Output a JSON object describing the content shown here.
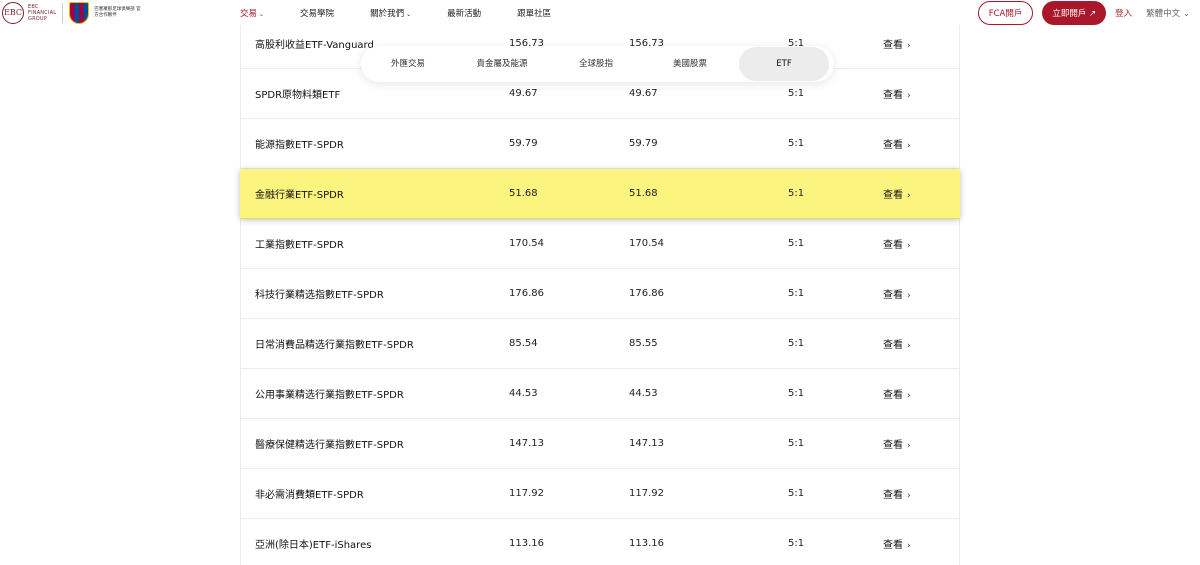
{
  "header": {
    "brand_mark": "EBC",
    "brand_text": [
      "EBC",
      "FINANCIAL",
      "GROUP"
    ],
    "partner_text": "巴塞羅那足球俱樂部 官方合作夥伴",
    "nav": [
      {
        "label": "交易",
        "dropdown": true,
        "active": true
      },
      {
        "label": "交易學院",
        "dropdown": false
      },
      {
        "label": "關於我們",
        "dropdown": true
      },
      {
        "label": "最新活動",
        "dropdown": false
      },
      {
        "label": "跟單社區",
        "dropdown": false
      }
    ],
    "fca_button": "FCA開戶",
    "open_button": "立即開戶 ↗",
    "login": "登入",
    "language": "繁體中文 ⌄"
  },
  "tabs": [
    {
      "label": "外匯交易"
    },
    {
      "label": "貴金屬及能源"
    },
    {
      "label": "全球股指"
    },
    {
      "label": "美國股票"
    },
    {
      "label": "ETF",
      "active": true
    }
  ],
  "rows": [
    {
      "name": "高股利收益ETF-Vanguard",
      "v1": "156.73",
      "v2": "156.73",
      "leverage": "5:1",
      "action": "查看"
    },
    {
      "name": "SPDR原物料類ETF",
      "v1": "49.67",
      "v2": "49.67",
      "leverage": "5:1",
      "action": "查看"
    },
    {
      "name": "能源指數ETF-SPDR",
      "v1": "59.79",
      "v2": "59.79",
      "leverage": "5:1",
      "action": "查看"
    },
    {
      "name": "金融行業ETF-SPDR",
      "v1": "51.68",
      "v2": "51.68",
      "leverage": "5:1",
      "action": "查看",
      "highlight": true
    },
    {
      "name": "工業指數ETF-SPDR",
      "v1": "170.54",
      "v2": "170.54",
      "leverage": "5:1",
      "action": "查看"
    },
    {
      "name": "科技行業精选指數ETF-SPDR",
      "v1": "176.86",
      "v2": "176.86",
      "leverage": "5:1",
      "action": "查看"
    },
    {
      "name": "日常消費品精选行業指數ETF-SPDR",
      "v1": "85.54",
      "v2": "85.55",
      "leverage": "5:1",
      "action": "查看"
    },
    {
      "name": "公用事業精选行業指數ETF-SPDR",
      "v1": "44.53",
      "v2": "44.53",
      "leverage": "5:1",
      "action": "查看"
    },
    {
      "name": "醫療保健精选行業指數ETF-SPDR",
      "v1": "147.13",
      "v2": "147.13",
      "leverage": "5:1",
      "action": "查看"
    },
    {
      "name": "非必需消費類ETF-SPDR",
      "v1": "117.92",
      "v2": "117.92",
      "leverage": "5:1",
      "action": "查看"
    },
    {
      "name": "亞洲(除日本)ETF-iShares",
      "v1": "113.16",
      "v2": "113.16",
      "leverage": "5:1",
      "action": "查看"
    }
  ],
  "colors": {
    "brand": "#a8182a",
    "highlight": "#fbf47f"
  },
  "icons": {
    "chevron": "chevron-right-icon",
    "caret": "chevron-down-icon"
  }
}
